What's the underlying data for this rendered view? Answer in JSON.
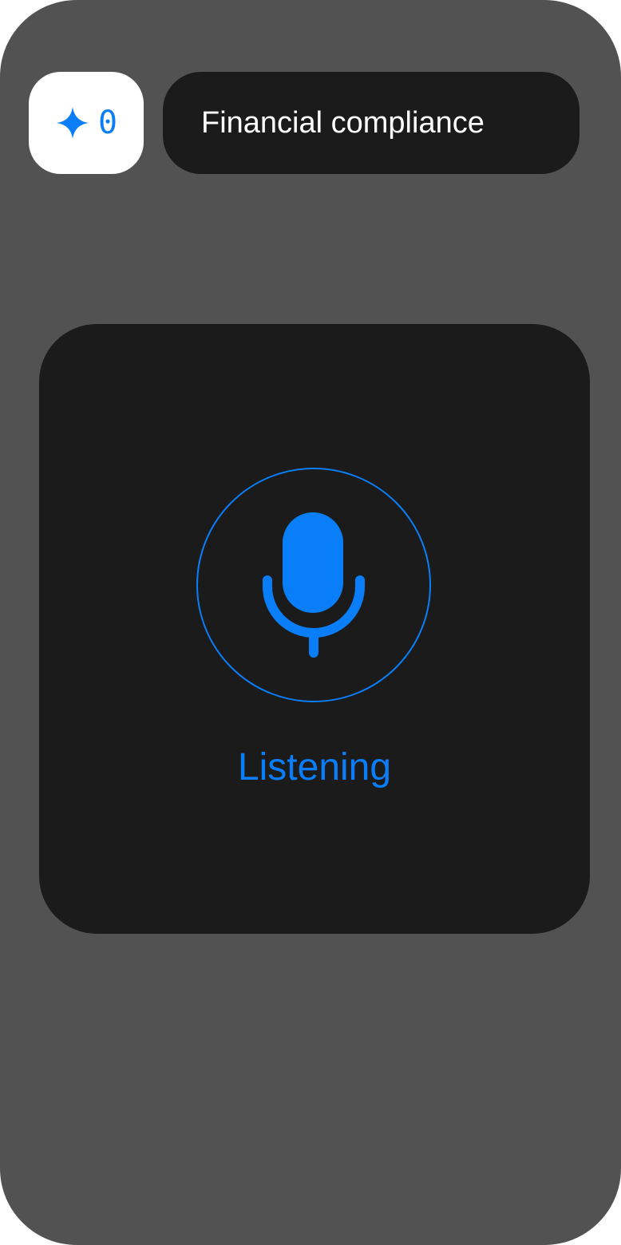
{
  "score": {
    "icon": "sparkle-star-icon",
    "value": "0"
  },
  "topic": {
    "label": "Financial compliance"
  },
  "voice": {
    "icon": "microphone-icon",
    "status": "Listening"
  },
  "colors": {
    "accent": "#0a7ef8",
    "background": "#525252",
    "card": "#1b1b1b",
    "pill_light": "#ffffff"
  }
}
